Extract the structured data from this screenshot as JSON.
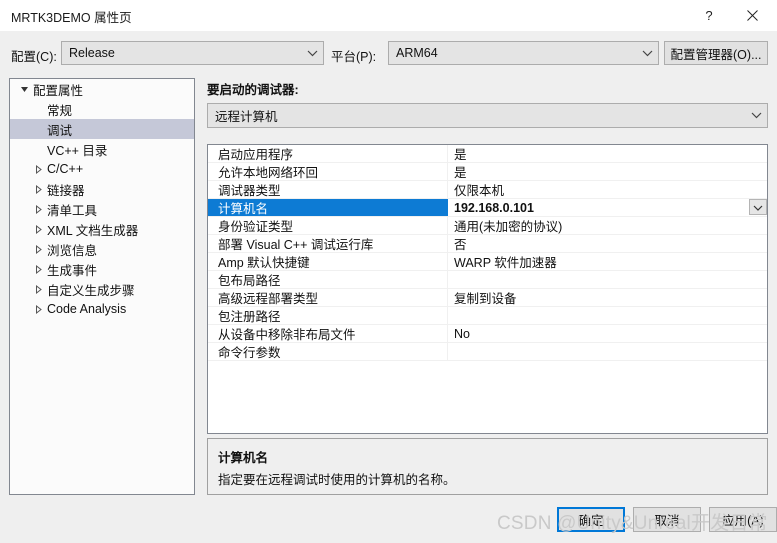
{
  "window": {
    "title": "MRTK3DEMO 属性页",
    "help_icon": "help-icon",
    "close_icon": "close-icon"
  },
  "config_bar": {
    "configuration_label": "配置(C):",
    "configuration_value": "Release",
    "platform_label": "平台(P):",
    "platform_value": "ARM64",
    "config_manager_button": "配置管理器(O)..."
  },
  "tree": {
    "items": [
      {
        "label": "配置属性",
        "indent": 0,
        "twisty": "expanded",
        "selected": false
      },
      {
        "label": "常规",
        "indent": 1,
        "twisty": "none",
        "selected": false
      },
      {
        "label": "调试",
        "indent": 1,
        "twisty": "none",
        "selected": true
      },
      {
        "label": "VC++ 目录",
        "indent": 1,
        "twisty": "none",
        "selected": false
      },
      {
        "label": "C/C++",
        "indent": 1,
        "twisty": "collapsed",
        "selected": false
      },
      {
        "label": "链接器",
        "indent": 1,
        "twisty": "collapsed",
        "selected": false
      },
      {
        "label": "清单工具",
        "indent": 1,
        "twisty": "collapsed",
        "selected": false
      },
      {
        "label": "XML 文档生成器",
        "indent": 1,
        "twisty": "collapsed",
        "selected": false
      },
      {
        "label": "浏览信息",
        "indent": 1,
        "twisty": "collapsed",
        "selected": false
      },
      {
        "label": "生成事件",
        "indent": 1,
        "twisty": "collapsed",
        "selected": false
      },
      {
        "label": "自定义生成步骤",
        "indent": 1,
        "twisty": "collapsed",
        "selected": false
      },
      {
        "label": "Code Analysis",
        "indent": 1,
        "twisty": "collapsed",
        "selected": false
      }
    ]
  },
  "main": {
    "debugger_label": "要启动的调试器:",
    "debugger_value": "远程计算机",
    "properties": [
      {
        "name": "启动应用程序",
        "value": "是",
        "selected": false
      },
      {
        "name": "允许本地网络环回",
        "value": "是",
        "selected": false
      },
      {
        "name": "调试器类型",
        "value": "仅限本机",
        "selected": false
      },
      {
        "name": "计算机名",
        "value": "192.168.0.101",
        "selected": true
      },
      {
        "name": "身份验证类型",
        "value": "通用(未加密的协议)",
        "selected": false
      },
      {
        "name": "部署 Visual C++ 调试运行库",
        "value": "否",
        "selected": false
      },
      {
        "name": "Amp 默认快捷键",
        "value": "WARP 软件加速器",
        "selected": false
      },
      {
        "name": "包布局路径",
        "value": "",
        "selected": false
      },
      {
        "name": "高级远程部署类型",
        "value": "复制到设备",
        "selected": false
      },
      {
        "name": "包注册路径",
        "value": "",
        "selected": false
      },
      {
        "name": "从设备中移除非布局文件",
        "value": "No",
        "selected": false
      },
      {
        "name": "命令行参数",
        "value": "",
        "selected": false
      }
    ],
    "description": {
      "title": "计算机名",
      "text": "指定要在远程调试时使用的计算机的名称。"
    }
  },
  "footer": {
    "ok_button": "确定",
    "cancel_button": "取消",
    "apply_button": "应用(A)"
  },
  "watermark": "CSDN @Unity&Unreal开发日常",
  "colors": {
    "accent": "#0078d7",
    "selected_row": "#0d7bd4",
    "tree_selected": "#c5c8d8",
    "dialog_bg": "#efefef"
  }
}
